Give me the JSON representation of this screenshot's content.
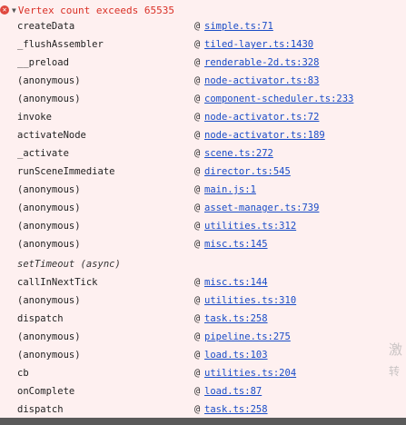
{
  "error": {
    "message": "Vertex count exceeds 65535",
    "icon": "error-icon",
    "toggle_icon": "triangle-down-icon"
  },
  "at_symbol": "@",
  "frames": [
    {
      "fn": "createData",
      "link": "simple.ts:71"
    },
    {
      "fn": "_flushAssembler",
      "link": "tiled-layer.ts:1430"
    },
    {
      "fn": "__preload",
      "link": "renderable-2d.ts:328"
    },
    {
      "fn": "(anonymous)",
      "link": "node-activator.ts:83"
    },
    {
      "fn": "(anonymous)",
      "link": "component-scheduler.ts:233"
    },
    {
      "fn": "invoke",
      "link": "node-activator.ts:72"
    },
    {
      "fn": "activateNode",
      "link": "node-activator.ts:189"
    },
    {
      "fn": "_activate",
      "link": "scene.ts:272"
    },
    {
      "fn": "runSceneImmediate",
      "link": "director.ts:545"
    },
    {
      "fn": "(anonymous)",
      "link": "main.js:1"
    },
    {
      "fn": "(anonymous)",
      "link": "asset-manager.ts:739"
    },
    {
      "fn": "(anonymous)",
      "link": "utilities.ts:312"
    },
    {
      "fn": "(anonymous)",
      "link": "misc.ts:145"
    }
  ],
  "async_label": "setTimeout (async)",
  "frames_after": [
    {
      "fn": "callInNextTick",
      "link": "misc.ts:144"
    },
    {
      "fn": "(anonymous)",
      "link": "utilities.ts:310"
    },
    {
      "fn": "dispatch",
      "link": "task.ts:258"
    },
    {
      "fn": "(anonymous)",
      "link": "pipeline.ts:275"
    },
    {
      "fn": "(anonymous)",
      "link": "load.ts:103"
    },
    {
      "fn": "cb",
      "link": "utilities.ts:204"
    },
    {
      "fn": "onComplete",
      "link": "load.ts:87"
    },
    {
      "fn": "dispatch",
      "link": "task.ts:258"
    }
  ],
  "watermark": [
    "激",
    "转"
  ]
}
